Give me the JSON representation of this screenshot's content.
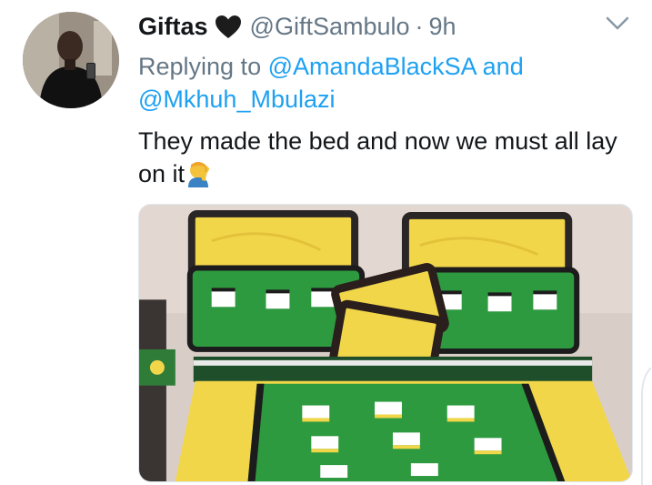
{
  "tweet": {
    "author": {
      "display_name": "Giftas",
      "handle": "@GiftSambulo",
      "badge_icon": "black-heart-icon"
    },
    "separator": "·",
    "time": "9h",
    "reply": {
      "prefix": "Replying to",
      "mention_1": "@AmandaBlackSA",
      "conjunction": "and",
      "mention_2": "@Mkhuh_Mbulazi"
    },
    "text": "They made the bed and now we must all lay on it",
    "text_emoji": "face-palm-emoji",
    "media": {
      "kind": "photo",
      "palette": {
        "green": "#2e9a3f",
        "yellow": "#f2d64a",
        "border": "#1c1c1c"
      }
    }
  },
  "colors": {
    "text_primary": "#14171a",
    "text_secondary": "#657786",
    "link": "#1da1f2",
    "background": "#ffffff"
  }
}
